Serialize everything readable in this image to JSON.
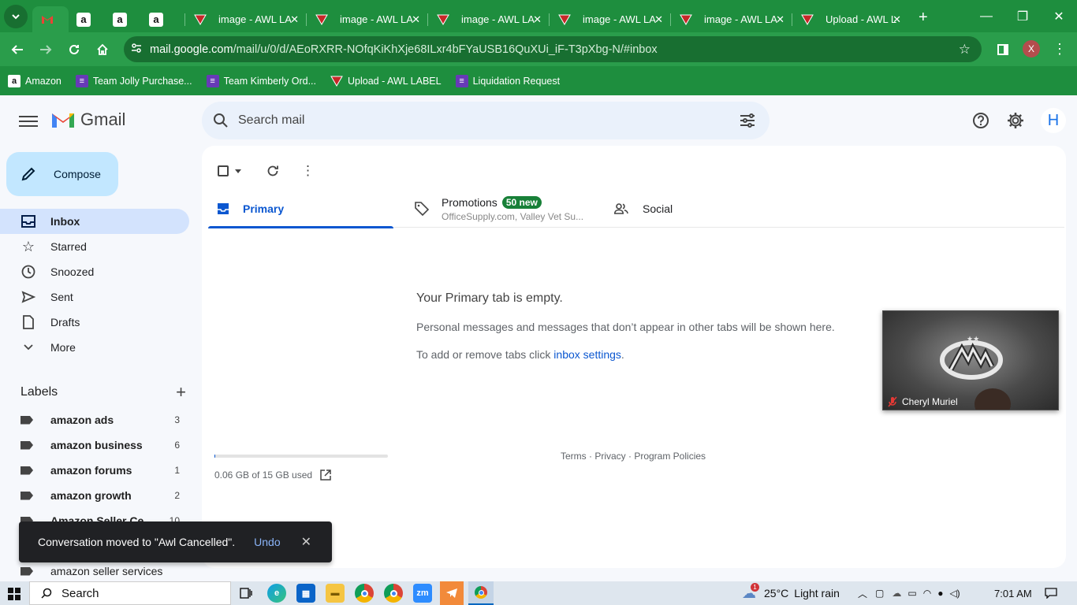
{
  "browser": {
    "tabs": [
      {
        "title": "",
        "favicon": "gmail-icon",
        "active": true
      },
      {
        "title": "",
        "favicon": "amazon-icon"
      },
      {
        "title": "",
        "favicon": "amazon-icon"
      },
      {
        "title": "",
        "favicon": "amazon-icon"
      },
      {
        "title": "image - AWL LA",
        "favicon": "awl-icon"
      },
      {
        "title": "image - AWL LA",
        "favicon": "awl-icon"
      },
      {
        "title": "image - AWL LA",
        "favicon": "awl-icon"
      },
      {
        "title": "image - AWL LA",
        "favicon": "awl-icon"
      },
      {
        "title": "image - AWL LA",
        "favicon": "awl-icon"
      },
      {
        "title": "Upload - AWL L",
        "favicon": "awl-icon"
      }
    ],
    "url_domain": "mail.google.com",
    "url_path": "/mail/u/0/d/AEoRXRR-NOfqKiKhXje68ILxr4bFYaUSB16QuXUi_iF-T3pXbg-N/#inbox",
    "profile_initial": "X",
    "bookmarks": [
      {
        "label": "Amazon",
        "icon": "amazon-icon"
      },
      {
        "label": "Team Jolly Purchase...",
        "icon": "forms-icon"
      },
      {
        "label": "Team Kimberly Ord...",
        "icon": "forms-icon"
      },
      {
        "label": "Upload - AWL LABEL",
        "icon": "awl-icon"
      },
      {
        "label": "Liquidation Request",
        "icon": "forms-icon"
      }
    ]
  },
  "gmail": {
    "brand": "Gmail",
    "search_placeholder": "Search mail",
    "avatar_initial": "H",
    "compose_label": "Compose",
    "nav": [
      {
        "label": "Inbox",
        "icon": "inbox-icon",
        "selected": true
      },
      {
        "label": "Starred",
        "icon": "star-icon"
      },
      {
        "label": "Snoozed",
        "icon": "clock-icon"
      },
      {
        "label": "Sent",
        "icon": "send-icon"
      },
      {
        "label": "Drafts",
        "icon": "draft-icon"
      },
      {
        "label": "More",
        "icon": "chevron-down-icon"
      }
    ],
    "labels_heading": "Labels",
    "labels": [
      {
        "name": "amazon ads",
        "count": "3"
      },
      {
        "name": "amazon business",
        "count": "6"
      },
      {
        "name": "amazon forums",
        "count": "1"
      },
      {
        "name": "amazon growth",
        "count": "2"
      },
      {
        "name": "Amazon Seller Ce...",
        "count": "10"
      },
      {
        "name": "",
        "count": ""
      },
      {
        "name": "amazon seller services",
        "count": ""
      }
    ],
    "tabs": {
      "primary": "Primary",
      "promotions": "Promotions",
      "promotions_badge": "50 new",
      "promotions_sub": "OfficeSupply.com, Valley Vet Su...",
      "social": "Social"
    },
    "empty": {
      "title": "Your Primary tab is empty.",
      "line1": "Personal messages and messages that don’t appear in other tabs will be shown here.",
      "line2_prefix": "To add or remove tabs click ",
      "line2_link": "inbox settings",
      "line2_suffix": "."
    },
    "storage": {
      "text": "0.06 GB of 15 GB used",
      "used_fraction": 0.004
    },
    "footer": "Terms · Privacy · Program Policies",
    "toast": {
      "message": "Conversation moved to \"Awl Cancelled\".",
      "undo": "Undo"
    }
  },
  "video_call": {
    "participant": "Cheryl Muriel"
  },
  "taskbar": {
    "search": "Search",
    "weather_temp": "25°C",
    "weather_desc": "Light rain",
    "weather_badge": "1",
    "time": "7:01 AM"
  }
}
